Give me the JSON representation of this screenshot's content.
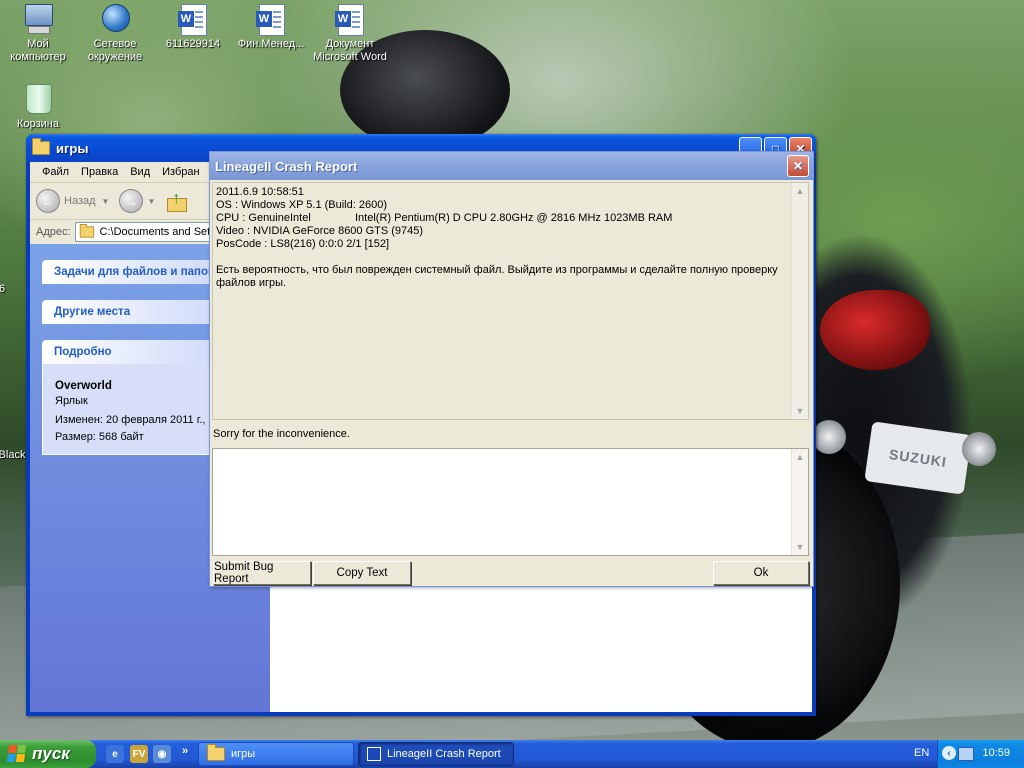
{
  "desktop": {
    "icons": [
      {
        "label": "Мой компьютер",
        "icon": "my-computer-icon"
      },
      {
        "label": "Сетевое окружение",
        "icon": "network-icon"
      },
      {
        "label": "611629914",
        "icon": "word-document-icon"
      },
      {
        "label": "Фин.Менед...",
        "icon": "word-document-icon"
      },
      {
        "label": "Документ Microsoft Word",
        "icon": "word-document-icon"
      },
      {
        "label": "Корзина",
        "icon": "recycle-bin-icon"
      }
    ],
    "wallpaper_plate": "SUZUKI",
    "partial_labels": [
      "6",
      "Black"
    ]
  },
  "explorer": {
    "title": "игры",
    "menu": [
      "Файл",
      "Правка",
      "Вид",
      "Избран"
    ],
    "back_label": "Назад",
    "address_label": "Адрес:",
    "address_value": "C:\\Documents and Setti",
    "tasks_header": "Задачи для файлов и папок",
    "other_places_header": "Другие места",
    "details_header": "Подробно",
    "details": {
      "name": "Overworld",
      "type": "Ярлык",
      "modified": "Изменен: 20 февраля 2011 г.,",
      "size": "Размер: 568 байт"
    }
  },
  "crash_report": {
    "title": "LineageII Crash Report",
    "lines": [
      "2011.6.9 10:58:51",
      "OS : Windows XP 5.1 (Build: 2600)",
      "CPU : GenuineIntel",
      "Intel(R) Pentium(R) D CPU 2.80GHz @ 2816 MHz 1023MB RAM",
      "Video : NVIDIA GeForce 8600 GTS (9745)",
      "PosCode : LS8(216) 0:0:0 2/1 [152]"
    ],
    "message": "Есть вероятность, что был поврежден системный файл. Выйдите из программы и сделайте полную проверку файлов игры.",
    "sorry": "Sorry for the inconvenience.",
    "comment_value": "",
    "buttons": {
      "submit": "Submit Bug Report",
      "copy": "Copy Text",
      "ok": "Ok"
    }
  },
  "taskbar": {
    "start_label": "пуск",
    "items": [
      {
        "label": "игры",
        "active": false
      },
      {
        "label": "LineageII Crash Report",
        "active": true
      }
    ],
    "language": "EN",
    "clock": "10:59"
  },
  "colors": {
    "xp_blue": "#0a4ad2",
    "start_green": "#3c9e3a",
    "dialog_face": "#ece9d8"
  }
}
